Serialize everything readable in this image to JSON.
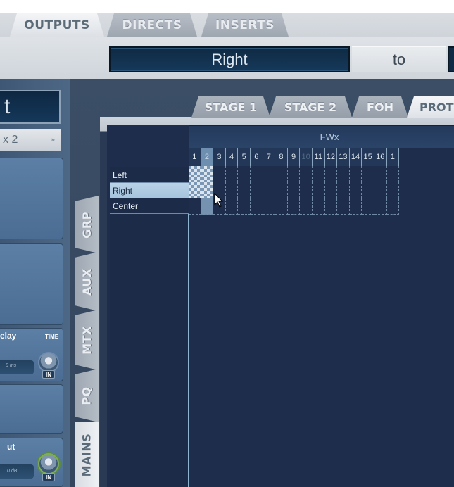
{
  "top_tabs": [
    {
      "label": "OUTPUTS",
      "active": true
    },
    {
      "label": "DIRECTS",
      "active": false
    },
    {
      "label": "INSERTS",
      "active": false
    }
  ],
  "header": {
    "source_name": "Right",
    "to_label": "to"
  },
  "left_strip": {
    "name_partial": "t",
    "sub_partial": "x 2",
    "sub_arrows": "»",
    "delay_label": "elay",
    "time_label": "TIME",
    "delay_value": "0 ms",
    "in_label": "IN",
    "out_label": "ut",
    "gain_value": "0 dB"
  },
  "side_tabs": [
    {
      "label": "GRP",
      "active": false
    },
    {
      "label": "AUX",
      "active": false
    },
    {
      "label": "MTX",
      "active": false
    },
    {
      "label": "PQ",
      "active": false
    },
    {
      "label": "MAINS",
      "active": true
    }
  ],
  "stage_tabs": [
    {
      "label": "STAGE 1",
      "active": false
    },
    {
      "label": "STAGE 2",
      "active": false
    },
    {
      "label": "FOH",
      "active": false
    },
    {
      "label": "PROT",
      "active": true
    }
  ],
  "matrix": {
    "title": "FWx",
    "columns": [
      "1",
      "2",
      "3",
      "4",
      "5",
      "6",
      "7",
      "8",
      "9",
      "10",
      "11",
      "12",
      "13",
      "14",
      "15",
      "16",
      "1"
    ],
    "dim_columns": [
      "10"
    ],
    "selected_column": "2",
    "rows": [
      {
        "label": "Left",
        "selected": false
      },
      {
        "label": "Right",
        "selected": true
      },
      {
        "label": "Center",
        "selected": false
      }
    ]
  },
  "colors": {
    "panel_dark": "#1e2d4b",
    "display_blue": "#0f2a44",
    "selected_row": "#a5c3dd",
    "accent_green": "#7fae5a"
  },
  "icons": [
    "cursor-arrow-icon",
    "fast-forward-icon",
    "knob-icon"
  ]
}
